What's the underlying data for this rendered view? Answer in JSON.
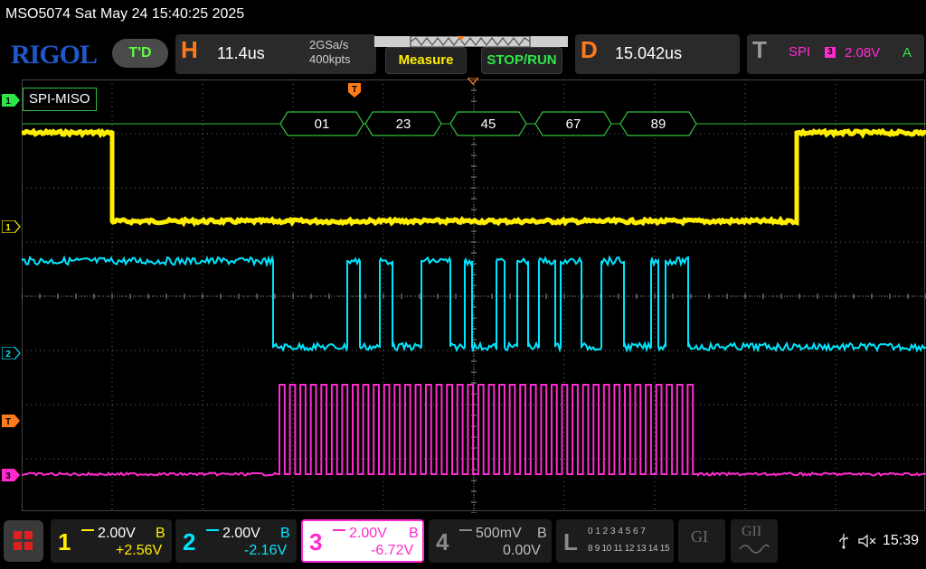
{
  "title": "MSO5074  Sat May 24 15:40:25 2025",
  "brand": "RIGOL",
  "trigger_status": "T'D",
  "horizontal": {
    "label": "H",
    "timebase": "11.4us",
    "sample_rate": "2GSa/s",
    "memory_depth": "400kpts"
  },
  "buttons": {
    "measure": "Measure",
    "stop_run": "STOP/RUN"
  },
  "delay": {
    "label": "D",
    "value": "15.042us"
  },
  "trigger": {
    "label": "T",
    "type": "SPI",
    "channel": "3",
    "level": "2.08V",
    "mode": "A"
  },
  "decode": {
    "label": "SPI-MISO",
    "values": [
      "01",
      "23",
      "45",
      "67",
      "89"
    ]
  },
  "channel_markers": [
    "1",
    "1",
    "2",
    "T",
    "3"
  ],
  "channels": [
    {
      "num": "1",
      "scale": "2.00V",
      "coupling": "B",
      "offset": "+2.56V",
      "color": "#ffee00"
    },
    {
      "num": "2",
      "scale": "2.00V",
      "coupling": "B",
      "offset": "-2.16V",
      "color": "#00e5ff"
    },
    {
      "num": "3",
      "scale": "2.00V",
      "coupling": "B",
      "offset": "-6.72V",
      "color": "#ff2bd0"
    },
    {
      "num": "4",
      "scale": "500mV",
      "coupling": "B",
      "offset": "0.00V",
      "color": "#8a8a8a"
    }
  ],
  "logic": {
    "label": "L",
    "row1": "0 1 2 3  4 5 6 7",
    "row2": "8 9 10 11  12 13 14 15"
  },
  "gen1": "GI",
  "gen2": "GII",
  "clock": "15:39",
  "colors": {
    "ch1": "#ffee00",
    "ch2": "#00e5ff",
    "ch3": "#ff2bd0",
    "trigger": "#ff7a1a",
    "decode": "#2fbf3f"
  }
}
